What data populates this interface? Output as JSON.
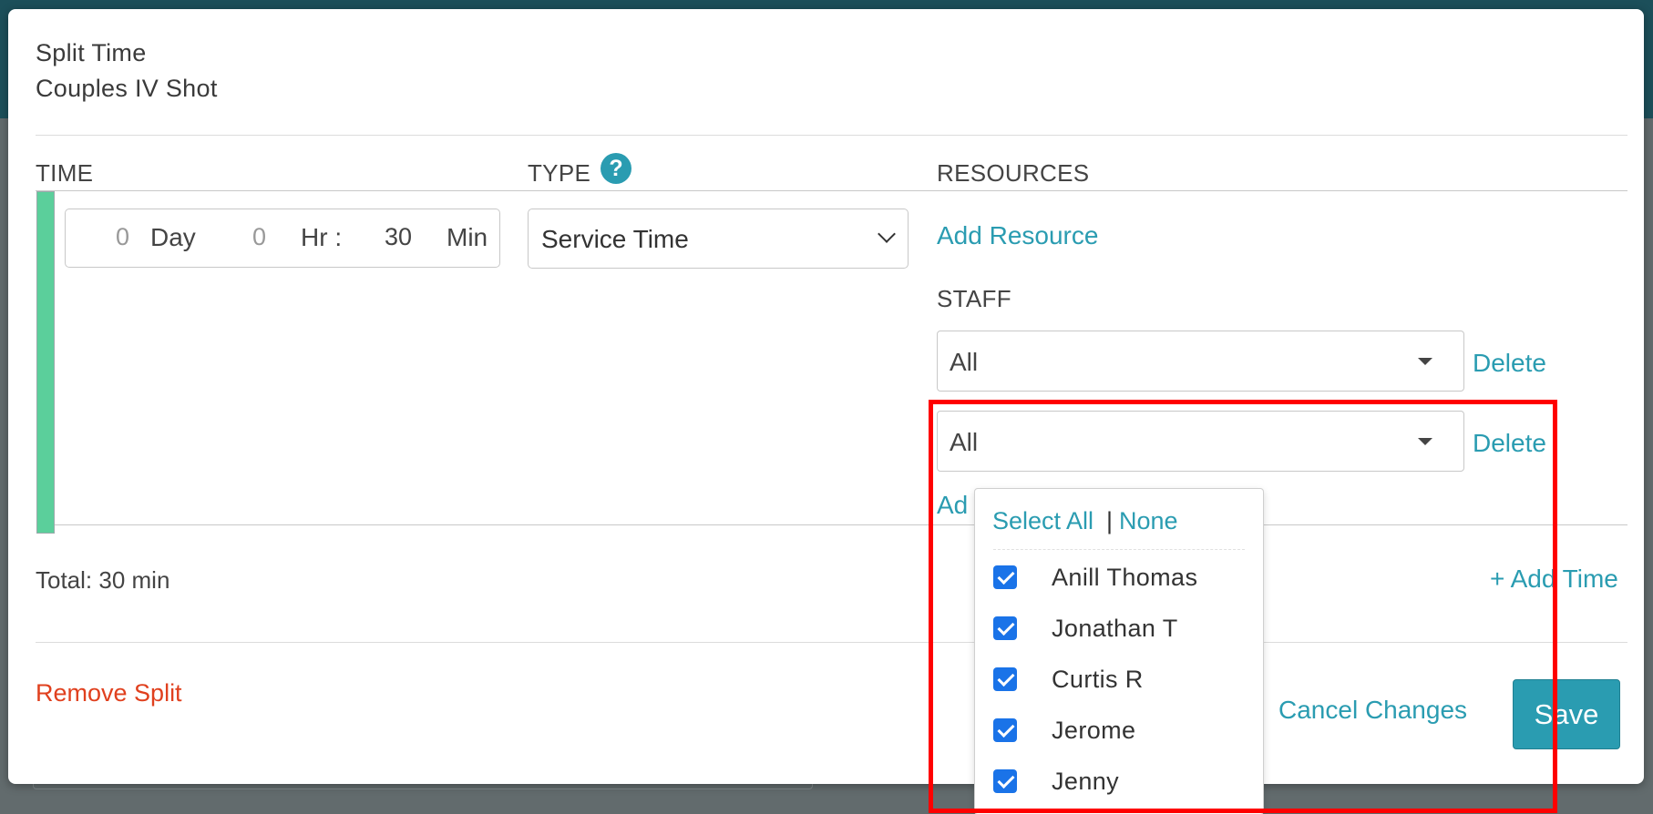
{
  "modal": {
    "title": "Split Time",
    "subtitle": "Couples IV Shot"
  },
  "columns": {
    "time": "TIME",
    "type": "TYPE",
    "resources": "RESOURCES"
  },
  "time": {
    "day_value": "0",
    "day_label": "Day",
    "hr_value": "0",
    "hr_label": "Hr :",
    "min_value": "30",
    "min_label": "Min"
  },
  "type_select": {
    "selected": "Service Time"
  },
  "resources": {
    "add_resource": "Add Resource",
    "staff_label": "STAFF",
    "staff_selects": [
      {
        "value": "All",
        "delete": "Delete"
      },
      {
        "value": "All",
        "delete": "Delete"
      }
    ],
    "add_link_partial": "Ad"
  },
  "dropdown": {
    "select_all": "Select All",
    "separator": "|",
    "none": "None",
    "options": [
      {
        "label": "Anill Thomas",
        "checked": true
      },
      {
        "label": "Jonathan T",
        "checked": true
      },
      {
        "label": "Curtis R",
        "checked": true
      },
      {
        "label": "Jerome",
        "checked": true
      },
      {
        "label": "Jenny",
        "checked": true
      }
    ]
  },
  "footer": {
    "total": "Total: 30 min",
    "add_time": "+ Add Time",
    "remove_split": "Remove Split",
    "cancel_changes": "Cancel Changes",
    "save": "Save"
  },
  "icons": {
    "help": "question-circle-icon",
    "checkbox": "checkbox-checked-icon",
    "caret": "caret-down-icon"
  },
  "colors": {
    "accent": "#2a9cb1",
    "danger": "#e0401e",
    "split_bar": "#5bcf9b",
    "highlight": "#ff0000",
    "checkbox": "#1a73e8"
  }
}
